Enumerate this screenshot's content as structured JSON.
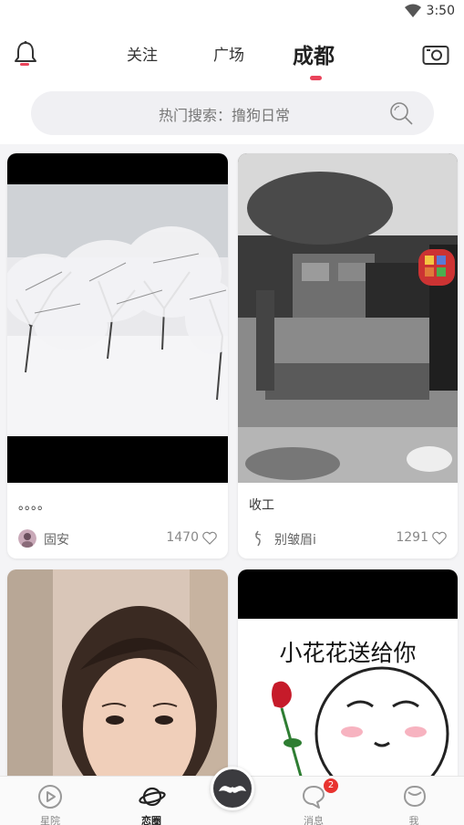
{
  "status_bar": {
    "time": "3:50"
  },
  "header": {
    "tabs": [
      "关注",
      "广场",
      "成都"
    ],
    "active_tab": "成都"
  },
  "search": {
    "placeholder_text": "热门搜索：撸狗日常"
  },
  "feed": [
    {
      "caption": "。。。。",
      "user": "固安",
      "likes": "1470",
      "image": "snowy-trees"
    },
    {
      "caption": "收工",
      "user": "别皱眉i",
      "likes": "1291",
      "image": "film-crew-restaurant"
    },
    {
      "caption": "",
      "user": "",
      "likes": "",
      "image": "woman-selfie"
    },
    {
      "caption": "",
      "user": "",
      "likes": "",
      "image": "meme-flower",
      "image_text": "小花花送给你"
    }
  ],
  "bottom_nav": {
    "items": [
      {
        "label": "星院",
        "icon": "play-circle-icon"
      },
      {
        "label": "恋圈",
        "icon": "planet-icon",
        "active": true
      },
      {
        "label": "",
        "icon": "mustache-icon"
      },
      {
        "label": "消息",
        "icon": "chat-bubble-icon",
        "badge": "2"
      },
      {
        "label": "我",
        "icon": "profile-icon"
      }
    ]
  },
  "colors": {
    "accent": "#e9435a",
    "badge": "#e8332f"
  }
}
